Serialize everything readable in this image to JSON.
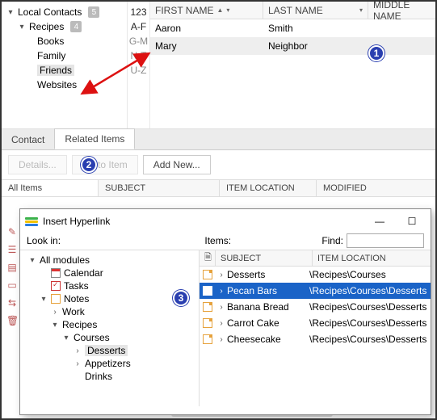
{
  "tree": {
    "root": {
      "label": "Local Contacts",
      "count": "5"
    },
    "recipes": {
      "label": "Recipes",
      "count": "4"
    },
    "books": "Books",
    "family": "Family",
    "friends": "Friends",
    "websites": "Websites"
  },
  "alpha": {
    "a": "123",
    "b": "A-F",
    "c": "G-M",
    "d": "N-T",
    "e": "U-Z"
  },
  "grid": {
    "cols": {
      "first": "FIRST NAME",
      "last": "LAST NAME",
      "middle": "MIDDLE NAME"
    },
    "rows": [
      {
        "first": "Aaron",
        "last": "Smith"
      },
      {
        "first": "Mary",
        "last": "Neighbor"
      }
    ]
  },
  "tabs": {
    "contact": "Contact",
    "related": "Related Items"
  },
  "toolbar": {
    "details": "Details...",
    "goto": "Go to Item",
    "addnew": "Add New..."
  },
  "related_cols": {
    "all": "All Items",
    "subject": "SUBJECT",
    "loc": "ITEM LOCATION",
    "mod": "MODIFIED"
  },
  "callouts": {
    "n1": "1",
    "n2": "2",
    "n3": "3"
  },
  "dialog": {
    "title": "Insert Hyperlink",
    "labels": {
      "lookin": "Look in:",
      "items": "Items:",
      "find": "Find:"
    },
    "find_value": "",
    "tree": {
      "all": "All modules",
      "calendar": "Calendar",
      "tasks": "Tasks",
      "notes": "Notes",
      "work": "Work",
      "recipes": "Recipes",
      "courses": "Courses",
      "desserts": "Desserts",
      "appetizers": "Appetizers",
      "drinks": "Drinks"
    },
    "grid": {
      "cols": {
        "subject": "SUBJECT",
        "loc": "ITEM LOCATION"
      },
      "rows": [
        {
          "subject": "Desserts",
          "loc": "\\Recipes\\Courses"
        },
        {
          "subject": "Pecan Bars",
          "loc": "\\Recipes\\Courses\\Desserts"
        },
        {
          "subject": "Banana Bread",
          "loc": "\\Recipes\\Courses\\Desserts"
        },
        {
          "subject": "Carrot Cake",
          "loc": "\\Recipes\\Courses\\Desserts"
        },
        {
          "subject": "Cheesecake",
          "loc": "\\Recipes\\Courses\\Desserts"
        }
      ]
    }
  }
}
